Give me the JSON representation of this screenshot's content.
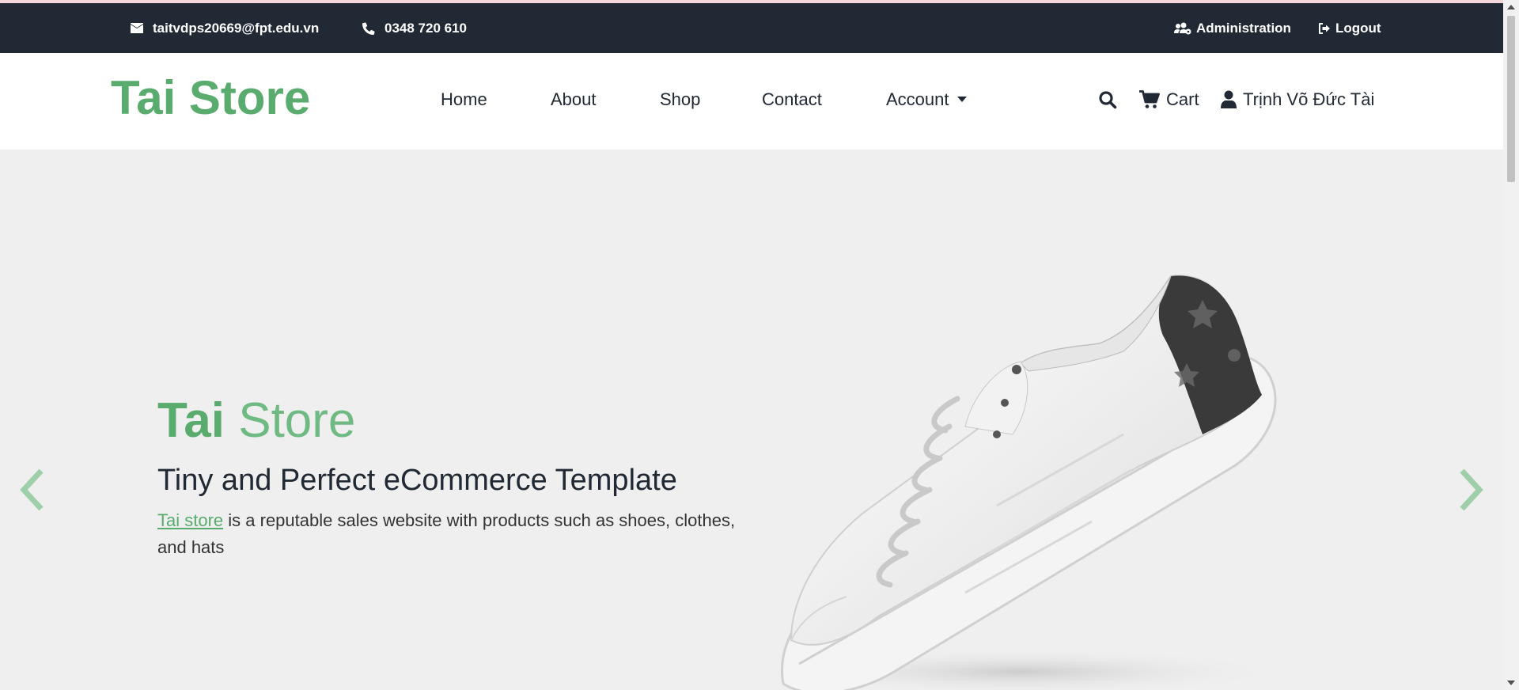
{
  "topbar": {
    "email": "taitvdps20669@fpt.edu.vn",
    "phone": "0348 720 610",
    "admin_label": "Administration",
    "logout_label": "Logout"
  },
  "navbar": {
    "brand": "Tai Store",
    "links": [
      "Home",
      "About",
      "Shop",
      "Contact",
      "Account"
    ],
    "cart_label": "Cart",
    "user_name": "Trịnh Võ Đức Tài"
  },
  "hero": {
    "title_bold": "Tai",
    "title_light": "Store",
    "subtitle": "Tiny and Perfect eCommerce Template",
    "desc_link": "Tai store",
    "desc_text": " is a reputable sales website with products such as shoes, clothes, and hats"
  },
  "colors": {
    "brand_green": "#59ab6e",
    "topbar_dark": "#212934",
    "hero_bg": "#efefef"
  },
  "icons": [
    "envelope-icon",
    "phone-icon",
    "users-cog-icon",
    "sign-out-icon",
    "search-icon",
    "cart-icon",
    "user-icon",
    "chevron-left-icon",
    "chevron-right-icon"
  ]
}
